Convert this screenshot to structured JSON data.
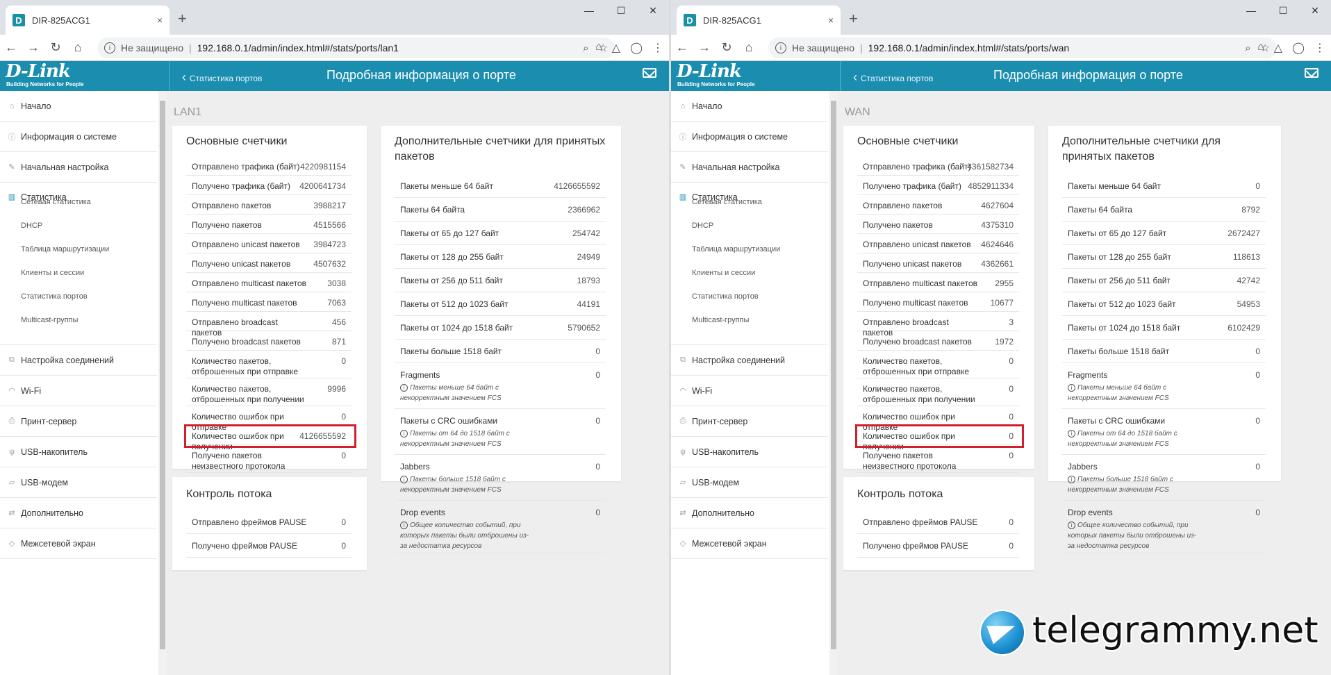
{
  "browser": {
    "tab_title": "DIR-825ACG1",
    "tab_close": "×",
    "new_tab": "+",
    "insecure": "Не защищено",
    "left_url": "192.168.0.1/admin/index.html#/stats/ports/lan1",
    "right_url": "192.168.0.1/admin/index.html#/stats/ports/wan"
  },
  "brand": {
    "logo": "D-Link",
    "tagline": "Building Networks for People"
  },
  "header": {
    "back_label": "Статистика портов",
    "title": "Подробная информация о порте"
  },
  "sidebar": {
    "items": [
      {
        "label": "Начало",
        "icon": "home-icon"
      },
      {
        "label": "Информация о системе",
        "icon": "info-icon"
      },
      {
        "label": "Начальная настройка",
        "icon": "wrench-icon"
      },
      {
        "label": "Статистика",
        "icon": "stats-icon"
      },
      {
        "label": "Настройка соединений",
        "icon": "connections-icon"
      },
      {
        "label": "Wi-Fi",
        "icon": "wifi-icon"
      },
      {
        "label": "Принт-сервер",
        "icon": "printer-icon"
      },
      {
        "label": "USB-накопитель",
        "icon": "usb-icon"
      },
      {
        "label": "USB-модем",
        "icon": "modem-icon"
      },
      {
        "label": "Дополнительно",
        "icon": "advanced-icon"
      },
      {
        "label": "Межсетевой экран",
        "icon": "shield-icon"
      }
    ],
    "sub": [
      "Сетевая статистика",
      "DHCP",
      "Таблица маршрутизации",
      "Клиенты и сессии",
      "Статистика портов",
      "Multicast-группы"
    ]
  },
  "cards": {
    "main_title": "Основные счетчики",
    "extra_title": "Дополнительные счетчики для принятых пакетов",
    "flow_title": "Контроль потока",
    "main_labels": [
      "Отправлено трафика (байт)",
      "Получено трафика (байт)",
      "Отправлено пакетов",
      "Получено пакетов",
      "Отправлено unicast пакетов",
      "Получено unicast пакетов",
      "Отправлено multicast пакетов",
      "Получено multicast пакетов",
      "Отправлено broadcast пакетов",
      "Получено broadcast пакетов",
      "Количество пакетов, отброшенных при отправке",
      "Количество пакетов, отброшенных при получении",
      "Количество ошибок при отправке",
      "Количество ошибок при получении",
      "Получено пакетов неизвестного протокола"
    ],
    "extra_labels": [
      "Пакеты меньше 64 байт",
      "Пакеты 64 байта",
      "Пакеты от 65 до 127 байт",
      "Пакеты от 128 до 255 байт",
      "Пакеты от 256 до 511 байт",
      "Пакеты от 512 до 1023 байт",
      "Пакеты от 1024 до 1518 байт",
      "Пакеты больше 1518 байт",
      "Fragments",
      "Пакеты с CRC ошибками",
      "Jabbers",
      "Drop events"
    ],
    "extra_notes": [
      "Пакеты меньше 64 байт с некорректным значением FCS",
      "Пакеты от 64 до 1518 байт с некорректным значением FCS",
      "Пакеты больше 1518 байт с некорректным значением FCS",
      "Общее количество событий, при которых пакеты были отброшены из-за недостатка ресурсов"
    ],
    "flow_labels": [
      "Отправлено фреймов PAUSE",
      "Получено фреймов PAUSE"
    ]
  },
  "lan1": {
    "port": "LAN1",
    "main_values": [
      "4220981154",
      "4200641734",
      "3988217",
      "4515566",
      "3984723",
      "4507632",
      "3038",
      "7063",
      "456",
      "871",
      "0",
      "9996",
      "0",
      "4126655592",
      "0"
    ],
    "extra_values": [
      "4126655592",
      "2366962",
      "254742",
      "24949",
      "18793",
      "44191",
      "5790652",
      "0",
      "0",
      "0",
      "0",
      "0"
    ],
    "flow_values": [
      "0",
      "0"
    ]
  },
  "wan": {
    "port": "WAN",
    "main_values": [
      "4361582734",
      "4852911334",
      "4627604",
      "4375310",
      "4624646",
      "4362661",
      "2955",
      "10677",
      "3",
      "1972",
      "0",
      "0",
      "0",
      "0",
      "0"
    ],
    "extra_values": [
      "0",
      "8792",
      "2672427",
      "118613",
      "42742",
      "54953",
      "6102429",
      "0",
      "0",
      "0",
      "0",
      "0"
    ],
    "flow_values": [
      "0",
      "0"
    ]
  },
  "watermark": "telegrammy.net"
}
